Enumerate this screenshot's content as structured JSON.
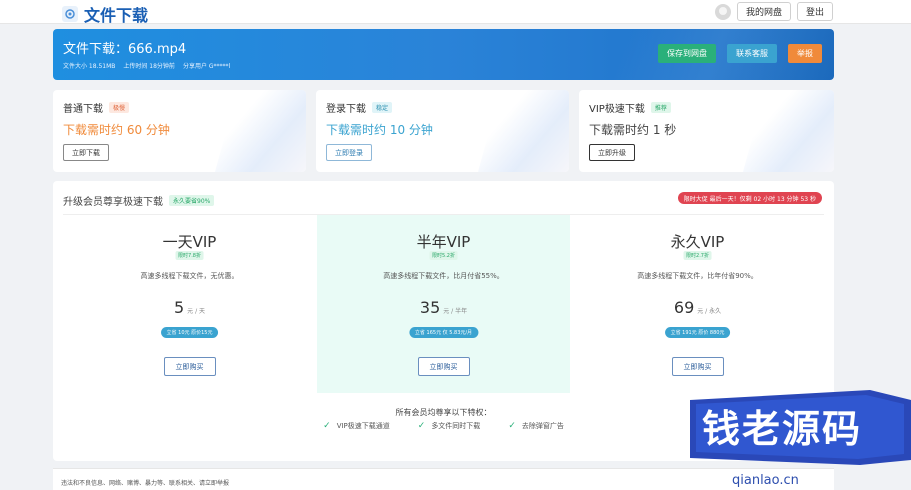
{
  "app": {
    "title": "文件下载"
  },
  "topbar": {
    "my_disk": "我的网盘",
    "logout": "登出"
  },
  "file": {
    "title": "文件下载：666.mp4",
    "size": "文件大小 18.51MB",
    "uploaded": "上传时间 18分钟前",
    "sharer": "分享用户 G*****l",
    "buttons": {
      "save": "保存到网盘",
      "support": "联系客服",
      "report": "举报"
    }
  },
  "options": [
    {
      "title": "普通下载",
      "tag": "极慢",
      "time": "下载需时约 60 分钟",
      "button": "立即下载"
    },
    {
      "title": "登录下载",
      "tag": "稳定",
      "time": "下载需时约 10 分钟",
      "button": "立即登录"
    },
    {
      "title": "VIP极速下载",
      "tag": "推荐",
      "time": "下载需时约 1 秒",
      "button": "立即升级"
    }
  ],
  "vip": {
    "title": "升级会员尊享极速下载",
    "tag": "永久要省90%",
    "countdown": "限时大促 最后一天！仅剩 02 小时 13 分钟 53 秒",
    "plans": [
      {
        "name": "一天VIP",
        "badge": "限时7.8折",
        "desc": "高速多线程下载文件，无优惠。",
        "price": "5",
        "unit": "元 / 天",
        "save": "立省 10元 原价15元",
        "buy": "立即购买"
      },
      {
        "name": "半年VIP",
        "badge": "限时5.2折",
        "desc": "高速多线程下载文件，比月付省55%。",
        "price": "35",
        "unit": "元 / 半年",
        "save": "立省 165元 仅 5.83元/月",
        "buy": "立即购买"
      },
      {
        "name": "永久VIP",
        "badge": "限时2.7折",
        "desc": "高速多线程下载文件，比年付省90%。",
        "price": "69",
        "unit": "元 / 永久",
        "save": "立省 191元 原价 880元",
        "buy": "立即购买"
      }
    ],
    "perks_title": "所有会员均尊享以下特权：",
    "perks": [
      "VIP极速下载通道",
      "多文件同时下载",
      "去除弹窗广告"
    ]
  },
  "footer": {
    "text": "违法和不良信息、网络、赌博、暴力等、联系相关、请立即举报"
  },
  "watermark": {
    "text": "钱老源码",
    "url": "qianlao.cn"
  },
  "colors": {
    "primary": "#1f8fe0",
    "green": "#2ab07a",
    "orange": "#f08a3a",
    "red": "#e04451"
  }
}
